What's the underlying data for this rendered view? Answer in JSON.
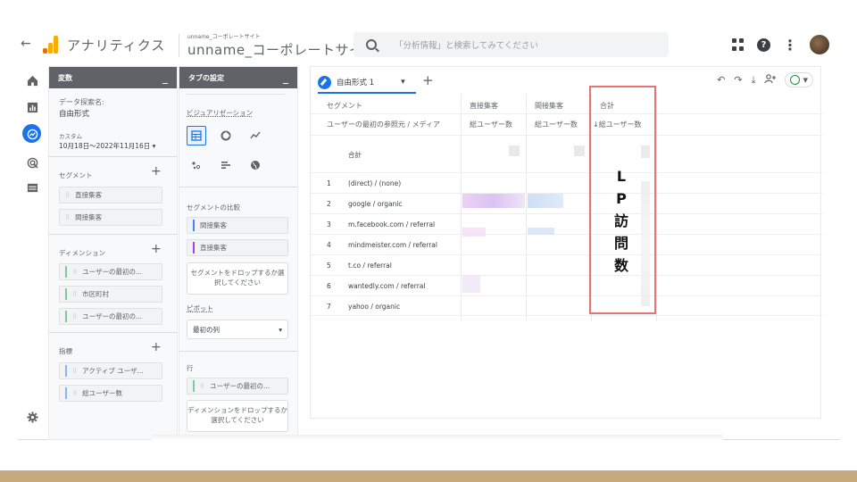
{
  "topbar": {
    "back_glyph": "←",
    "app_name": "アナリティクス",
    "property_small": "unname_コーポレートサイト",
    "property_main": "unname_コーポレートサイト",
    "search_placeholder": "「分析情報」と検索してみてください"
  },
  "variables_panel": {
    "title": "変数",
    "min_glyph": "_",
    "exploration_label": "データ探索名:",
    "exploration_name": "自由形式",
    "date_label": "カスタム",
    "date_value": "10月18日～2022年11月16日 ▾",
    "segments_title": "セグメント",
    "segments": [
      "直接集客",
      "間接集客"
    ],
    "dimensions_title": "ディメンション",
    "dimensions": [
      "ユーザーの最初の...",
      "市区町村",
      "ユーザーの最初の..."
    ],
    "metrics_title": "指標",
    "metrics": [
      "アクティブ ユーザ...",
      "総ユーザー数"
    ]
  },
  "tab_settings": {
    "title": "タブの設定",
    "min_glyph": "_",
    "viz_title": "ビジュアリゼーション",
    "segment_compare_title": "セグメントの比較",
    "segment_compare": [
      "間接集客",
      "直接集客"
    ],
    "segment_drop_text": "セグメントをドロップするか選択してください",
    "pivot_title": "ピボット",
    "pivot_value": "最初の列",
    "rows_title": "行",
    "row_chip": "ユーザーの最初の...",
    "dimension_drop_text": "ディメンションをドロップするか選択してください"
  },
  "canvas": {
    "tab_name": "自由形式 1",
    "tab_dropdown": "▾",
    "add_tab": "+",
    "header": {
      "segment": "セグメント",
      "direct": "直接集客",
      "indirect": "間接集客",
      "total": "合計",
      "dimension": "ユーザーの最初の参照元 / メディア",
      "metric1": "総ユーザー数",
      "metric2": "総ユーザー数",
      "metric3": "↓総ユーザー数",
      "total_row": "合計"
    },
    "rows": [
      {
        "num": "1",
        "label": "(direct) / (none)"
      },
      {
        "num": "2",
        "label": "google / organic"
      },
      {
        "num": "3",
        "label": "m.facebook.com / referral"
      },
      {
        "num": "4",
        "label": "mindmeister.com / referral"
      },
      {
        "num": "5",
        "label": "t.co / referral"
      },
      {
        "num": "6",
        "label": "wantedly.com / referral"
      },
      {
        "num": "7",
        "label": "yahoo / organic"
      }
    ]
  },
  "annotation": {
    "lines": [
      "L",
      "P",
      "訪",
      "問",
      "数"
    ],
    "border_color": "#e57373"
  },
  "colors": {
    "accent": "#1a73e8",
    "bottom_band": "#c8a97e"
  }
}
